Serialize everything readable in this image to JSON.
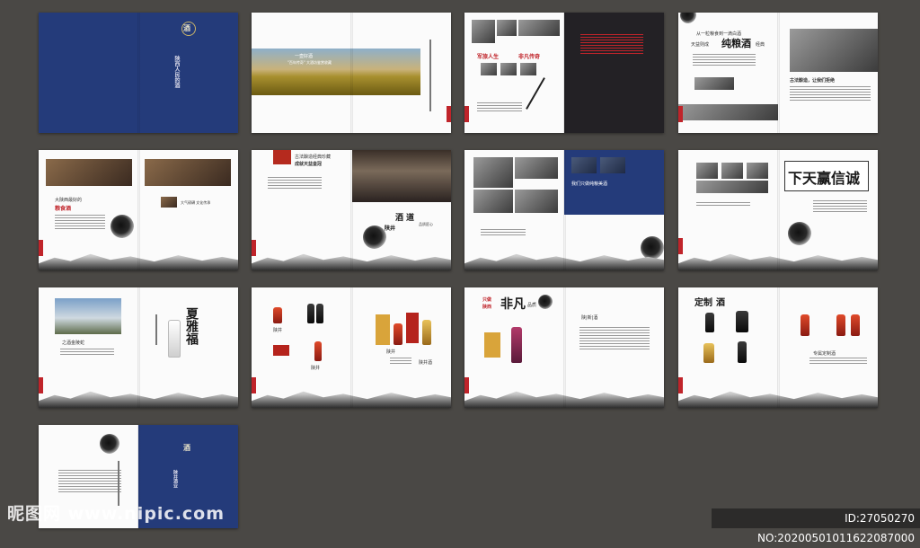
{
  "spreads": [
    {
      "id": "s1",
      "texts": [
        "酒",
        "陕西人民的酒"
      ]
    },
    {
      "id": "s2",
      "texts": [
        "一壶好酒",
        "\"百年传奇\" 大酒坊鉴赏收藏"
      ]
    },
    {
      "id": "s3",
      "texts": [
        "军旅人生",
        "非凡传奇"
      ]
    },
    {
      "id": "s4",
      "texts": [
        "从一粒粮食到一滴白酒",
        "天益则成",
        "纯粮酒",
        "经典",
        "古法酿造，让我们拒绝"
      ]
    },
    {
      "id": "s5",
      "texts": [
        "大陕西最好的",
        "粮食酒",
        "大气磅礴 文化传承"
      ]
    },
    {
      "id": "s6",
      "texts": [
        "古法酿造经典珍藏",
        "成就天益皇冠",
        "陕井",
        "酒",
        "道",
        "品质匠心"
      ]
    },
    {
      "id": "s7",
      "texts": [
        "我们只做纯粮美酒"
      ]
    },
    {
      "id": "s8",
      "texts": [
        "下天赢信诚",
        "诚信赢天下"
      ]
    },
    {
      "id": "s9",
      "texts": [
        "之酒金陵蛇",
        "夏雅福"
      ]
    },
    {
      "id": "s10",
      "texts": [
        "陕井",
        "陕井",
        "陕井",
        "陕井酒"
      ]
    },
    {
      "id": "s11",
      "texts": [
        "只做",
        "陕西",
        "非凡",
        "品质",
        "陕|新|酒"
      ]
    },
    {
      "id": "s12",
      "texts": [
        "定制",
        "酒",
        "专属定制酒"
      ]
    },
    {
      "id": "s13",
      "texts": [
        "酒",
        "陕井酒业"
      ]
    }
  ],
  "watermark": "昵图网 www.nipic.com",
  "image_id": "ID:27050270 NO:20200501011622087000"
}
